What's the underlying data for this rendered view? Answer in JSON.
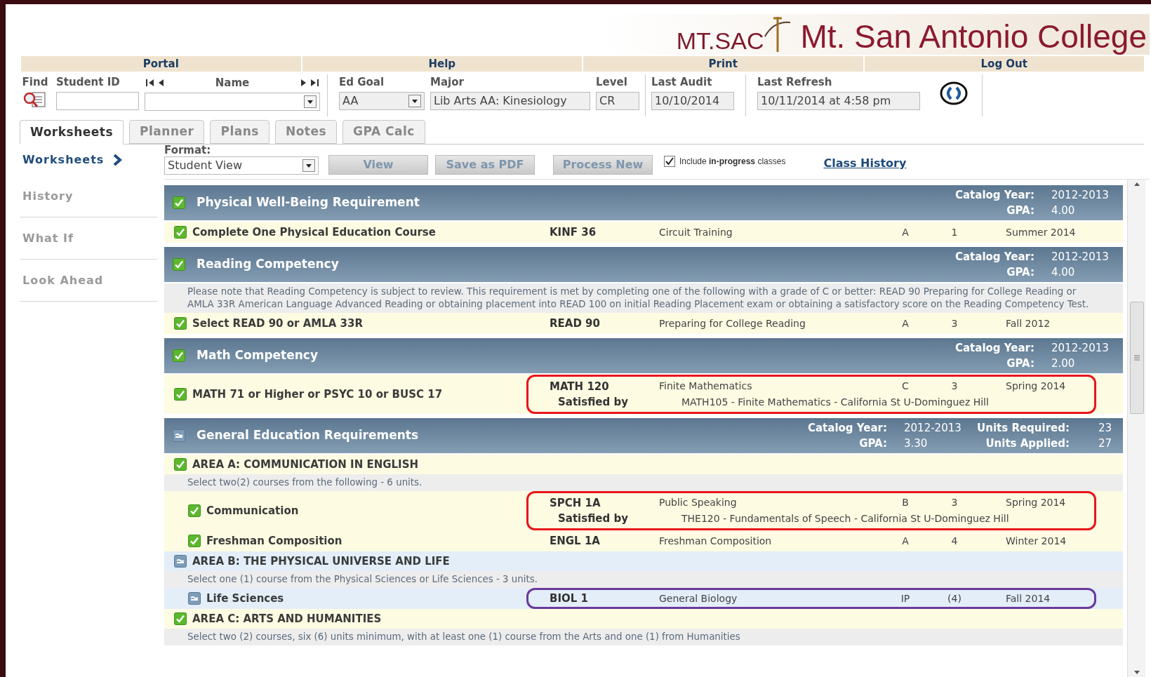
{
  "logo": {
    "mark": "MT.SAC",
    "name": "Mt. San Antonio College"
  },
  "nav": [
    "Portal",
    "Help",
    "Print",
    "Log Out"
  ],
  "lookup": {
    "find_label": "Find",
    "student_id_label": "Student ID",
    "name_label": "Name",
    "ed_goal_label": "Ed Goal",
    "ed_goal": "AA",
    "major_label": "Major",
    "major": "Lib Arts AA: Kinesiology",
    "level_label": "Level",
    "level_code": "CR",
    "last_audit_label": "Last Audit",
    "last_audit": "10/10/2014",
    "last_refresh_label": "Last Refresh",
    "last_refresh": "10/11/2014 at 4:58 pm"
  },
  "tabs": [
    {
      "label": "Worksheets",
      "selected": true
    },
    {
      "label": "Planner",
      "selected": false
    },
    {
      "label": "Plans",
      "selected": false
    },
    {
      "label": "Notes",
      "selected": false
    },
    {
      "label": "GPA Calc",
      "selected": false
    }
  ],
  "sidebar": [
    {
      "label": "Worksheets",
      "selected": true
    },
    {
      "label": "History",
      "selected": false
    },
    {
      "label": "What If",
      "selected": false
    },
    {
      "label": "Look Ahead",
      "selected": false
    }
  ],
  "toolbar": {
    "format_label": "Format:",
    "format": "Student View",
    "buttons": [
      "View",
      "Save as PDF",
      "Process New"
    ],
    "include": {
      "label": "Include **in-progress** classes",
      "checked": true
    },
    "link": "Class History"
  },
  "blocks": [
    {
      "title": "Physical Well-Being Requirement",
      "complete": true,
      "stats": [
        [
          {
            "label": "Catalog Year:",
            "value": "2012-2013"
          }
        ],
        [
          {
            "label": "GPA:",
            "value": "4.00"
          }
        ]
      ],
      "rows": [
        {
          "kind": "course",
          "complete": true,
          "label": "Complete One Physical Education Course",
          "course": {
            "code": "KINF 36",
            "title": "Circuit Training",
            "grade": "A",
            "credits": "1",
            "term": "Summer 2014"
          }
        }
      ]
    },
    {
      "title": "Reading Competency",
      "complete": true,
      "stats": [
        [
          {
            "label": "Catalog Year:",
            "value": "2012-2013"
          }
        ],
        [
          {
            "label": "GPA:",
            "value": "4.00"
          }
        ]
      ],
      "rows": [
        {
          "kind": "note",
          "text": "Please note that Reading Competency is subject to review. This requirement is met by completing one of the following with a grade of C or better: READ 90 Preparing for College Reading or AMLA 33R American Language Advanced Reading or obtaining placement into READ 100 on initial Reading Placement exam or obtaining a satisfactory score on the Reading Competency Test."
        },
        {
          "kind": "course",
          "complete": true,
          "label": "Select READ 90 or AMLA 33R",
          "course": {
            "code": "READ 90",
            "title": "Preparing for College Reading",
            "grade": "A",
            "credits": "3",
            "term": "Fall 2012"
          }
        }
      ]
    },
    {
      "title": "Math Competency",
      "complete": true,
      "stats": [
        [
          {
            "label": "Catalog Year:",
            "value": "2012-2013"
          }
        ],
        [
          {
            "label": "GPA:",
            "value": "2.00"
          }
        ]
      ],
      "rows": [
        {
          "kind": "course",
          "complete": true,
          "label": "MATH 71 or Higher or PSYC 10 or BUSC 17",
          "course": {
            "code": "MATH 120",
            "title": "Finite Mathematics",
            "grade": "C",
            "credits": "3",
            "term": "Spring 2014"
          },
          "satisfied_by": {
            "label": "Satisfied by",
            "text": "MATH105 - Finite Mathematics - California St U-Dominguez Hill"
          },
          "color": "#e8161b"
        }
      ]
    },
    {
      "title": "General Education Requirements",
      "complete": false,
      "stats": [
        [
          {
            "label": "Catalog Year:",
            "value": "2012-2013"
          },
          {
            "label": "Units Required:",
            "value": "23"
          }
        ],
        [
          {
            "label": "GPA:",
            "value": "3.30"
          },
          {
            "label": "Units Applied:",
            "value": "27"
          }
        ]
      ],
      "rows": [
        {
          "kind": "area",
          "complete": true,
          "label": "AREA A: COMMUNICATION IN ENGLISH",
          "note": "Select two(2) courses from the following - 6 units.",
          "children": [
            {
              "kind": "course",
              "complete": true,
              "label": "Communication",
              "course": {
                "code": "SPCH 1A",
                "title": "Public Speaking",
                "grade": "B",
                "credits": "3",
                "term": "Spring 2014"
              },
              "satisfied_by": {
                "label": "Satisfied by",
                "text": "THE120 - Fundamentals of Speech - California St U-Dominguez Hill"
              },
              "color": "#e8161b"
            },
            {
              "kind": "course",
              "complete": true,
              "label": "Freshman Composition",
              "course": {
                "code": "ENGL 1A",
                "title": "Freshman Composition",
                "grade": "A",
                "credits": "4",
                "term": "Winter 2014"
              }
            }
          ]
        },
        {
          "kind": "area",
          "complete": false,
          "label": "AREA B: THE PHYSICAL UNIVERSE AND LIFE",
          "note": "Select one (1) course from the Physical Sciences or Life Sciences - 3 units.",
          "children": [
            {
              "kind": "course",
              "complete": false,
              "label": "Life Sciences",
              "course": {
                "code": "BIOL 1",
                "title": "General Biology",
                "grade": "IP",
                "credits": "(4)",
                "term": "Fall 2014"
              },
              "color": "#6a3a9c"
            }
          ]
        },
        {
          "kind": "area",
          "complete": true,
          "label": "AREA C: ARTS AND HUMANITIES",
          "note": "Select two (2) courses, six (6) units minimum, with at least one (1)  course from the Arts and one (1) from Humanities"
        }
      ]
    }
  ]
}
